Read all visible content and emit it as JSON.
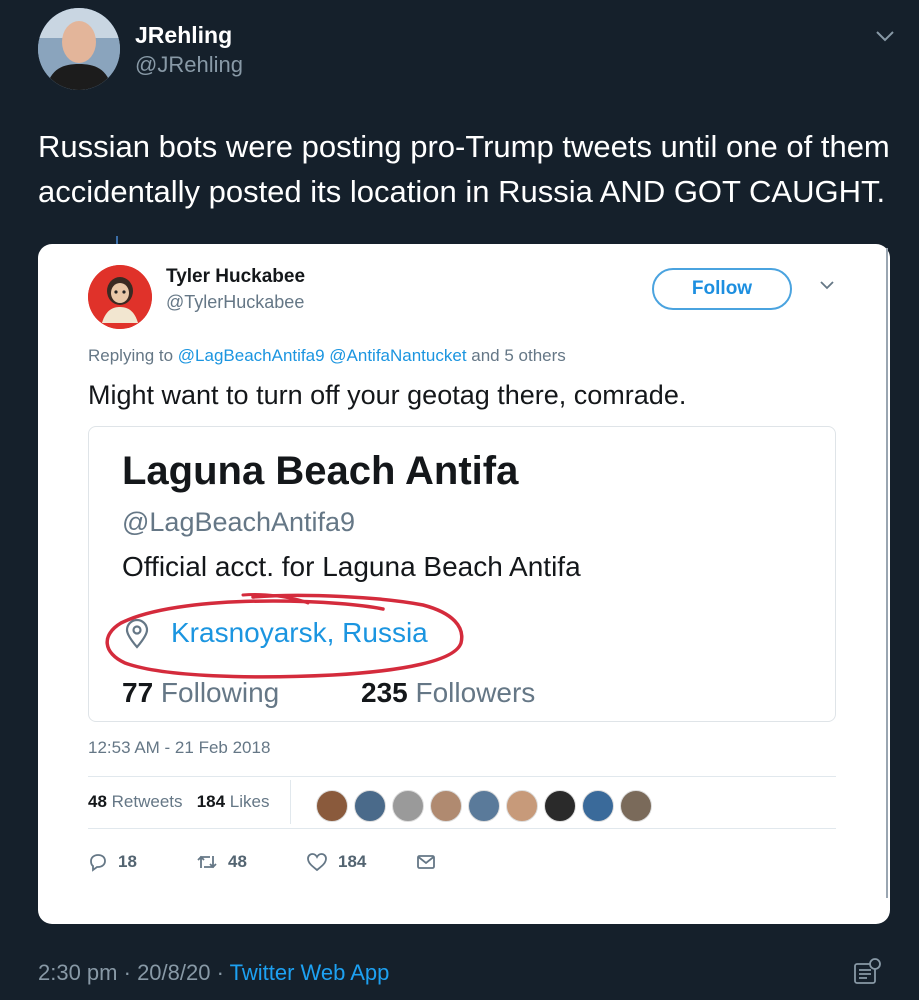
{
  "outer_tweet": {
    "display_name": "JRehling",
    "handle": "@JRehling",
    "text": "Russian bots were posting pro-Trump tweets until one of them accidentally posted its location in Russia AND GOT CAUGHT.",
    "time": "2:30 pm",
    "separator": " · ",
    "date": "20/8/20",
    "source": "Twitter Web App"
  },
  "embedded_tweet": {
    "display_name": "Tyler Huckabee",
    "handle": "@TylerHuckabee",
    "follow_label": "Follow",
    "replying_prefix": "Replying to ",
    "mention_1": "@LagBeachAntifa9",
    "mention_2": "@AntifaNantucket",
    "replying_suffix": " and 5 others",
    "text": "Might want to turn off your geotag there, comrade.",
    "timestamp": "12:53 AM - 21 Feb 2018",
    "retweets_count": "48",
    "retweets_label": " Retweets",
    "likes_count": "184",
    "likes_label": " Likes",
    "reply_count": "18",
    "retweet_action_count": "48",
    "like_action_count": "184"
  },
  "quoted_profile": {
    "name": "Laguna Beach Antifa",
    "handle": "@LagBeachAntifa9",
    "bio": "Official acct. for Laguna Beach Antifa",
    "location": "Krasnoyarsk, Russia",
    "following_count": "77",
    "following_label": " Following",
    "followers_count": "235",
    "followers_label": " Followers"
  },
  "likers": [
    {
      "color": "#8a5a3c"
    },
    {
      "color": "#4a6a8a"
    },
    {
      "color": "#9a9a9a"
    },
    {
      "color": "#b08a70"
    },
    {
      "color": "#5a7a9a"
    },
    {
      "color": "#c79a7a"
    },
    {
      "color": "#2a2a2a"
    },
    {
      "color": "#3a6a9a"
    },
    {
      "color": "#7a6a5a"
    }
  ],
  "colors": {
    "background": "#15202b",
    "accent": "#1da1f2",
    "circle_annotation": "#d42b3c"
  }
}
